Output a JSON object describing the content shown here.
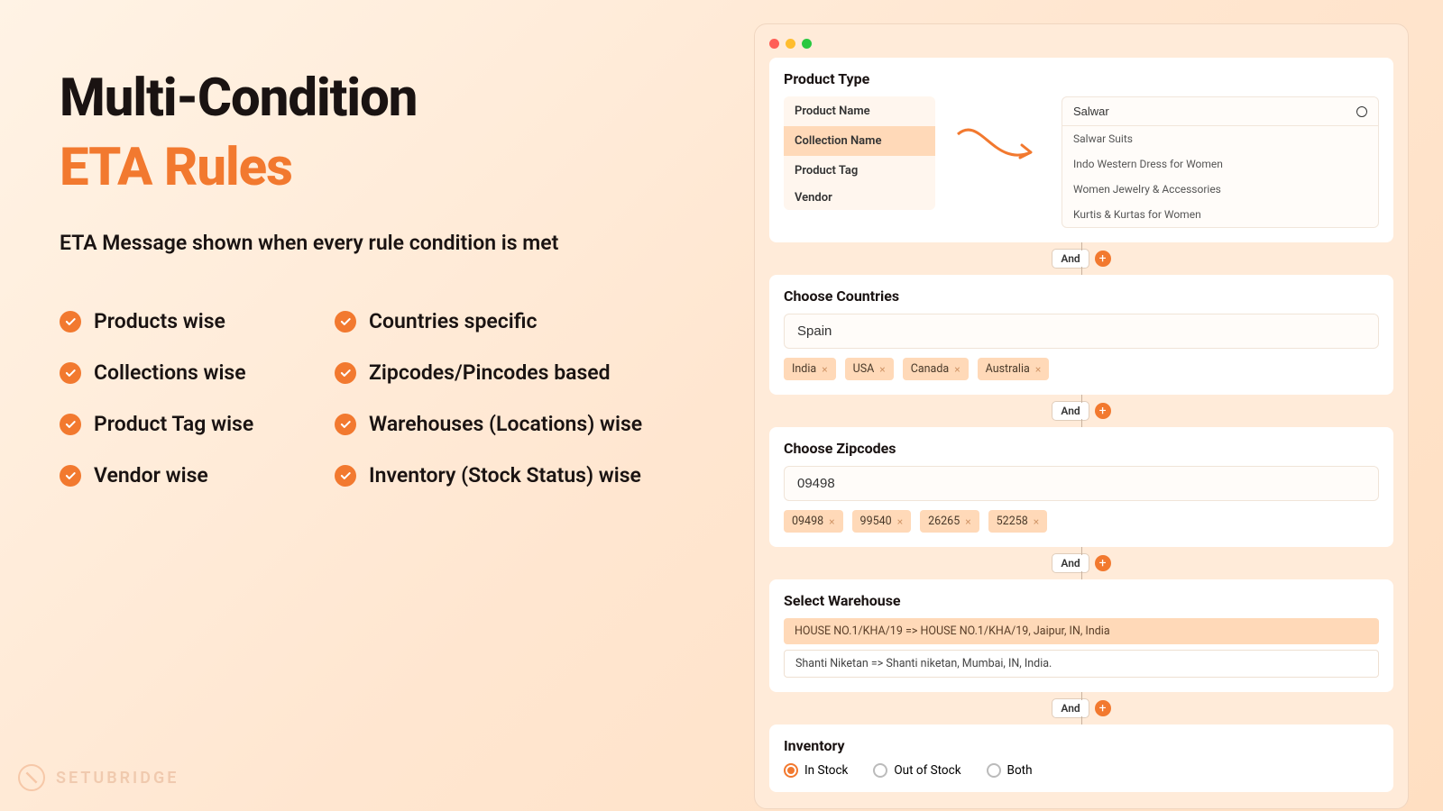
{
  "headline": {
    "line1": "Multi-Condition",
    "line2": "ETA Rules"
  },
  "subhead": "ETA Message shown when every rule condition is met",
  "features": {
    "col1": [
      "Products wise",
      "Collections wise",
      "Product Tag wise",
      "Vendor wise"
    ],
    "col2": [
      "Countries specific",
      "Zipcodes/Pincodes based",
      "Warehouses (Locations) wise",
      "Inventory (Stock Status) wise"
    ]
  },
  "brand": "SETUBRIDGE",
  "connector_label": "And",
  "product_type": {
    "title": "Product Type",
    "options": [
      "Product Name",
      "Collection Name",
      "Product Tag",
      "Vendor"
    ],
    "selected_index": 1,
    "search_value": "Salwar",
    "results": [
      "Salwar Suits",
      "Indo Western Dress for Women",
      "Women Jewelry & Accessories",
      "Kurtis & Kurtas for Women"
    ]
  },
  "countries": {
    "title": "Choose Countries",
    "input": "Spain",
    "chips": [
      "India",
      "USA",
      "Canada",
      "Australia"
    ]
  },
  "zipcodes": {
    "title": "Choose Zipcodes",
    "input": "09498",
    "chips": [
      "09498",
      "99540",
      "26265",
      "52258"
    ]
  },
  "warehouse": {
    "title": "Select Warehouse",
    "items": [
      {
        "text": "HOUSE NO.1/KHA/19 => HOUSE NO.1/KHA/19, Jaipur, IN, India",
        "selected": true
      },
      {
        "text": "Shanti Niketan => Shanti niketan, Mumbai, IN, India.",
        "selected": false
      }
    ]
  },
  "inventory": {
    "title": "Inventory",
    "options": [
      "In Stock",
      "Out of Stock",
      "Both"
    ],
    "selected_index": 0
  }
}
